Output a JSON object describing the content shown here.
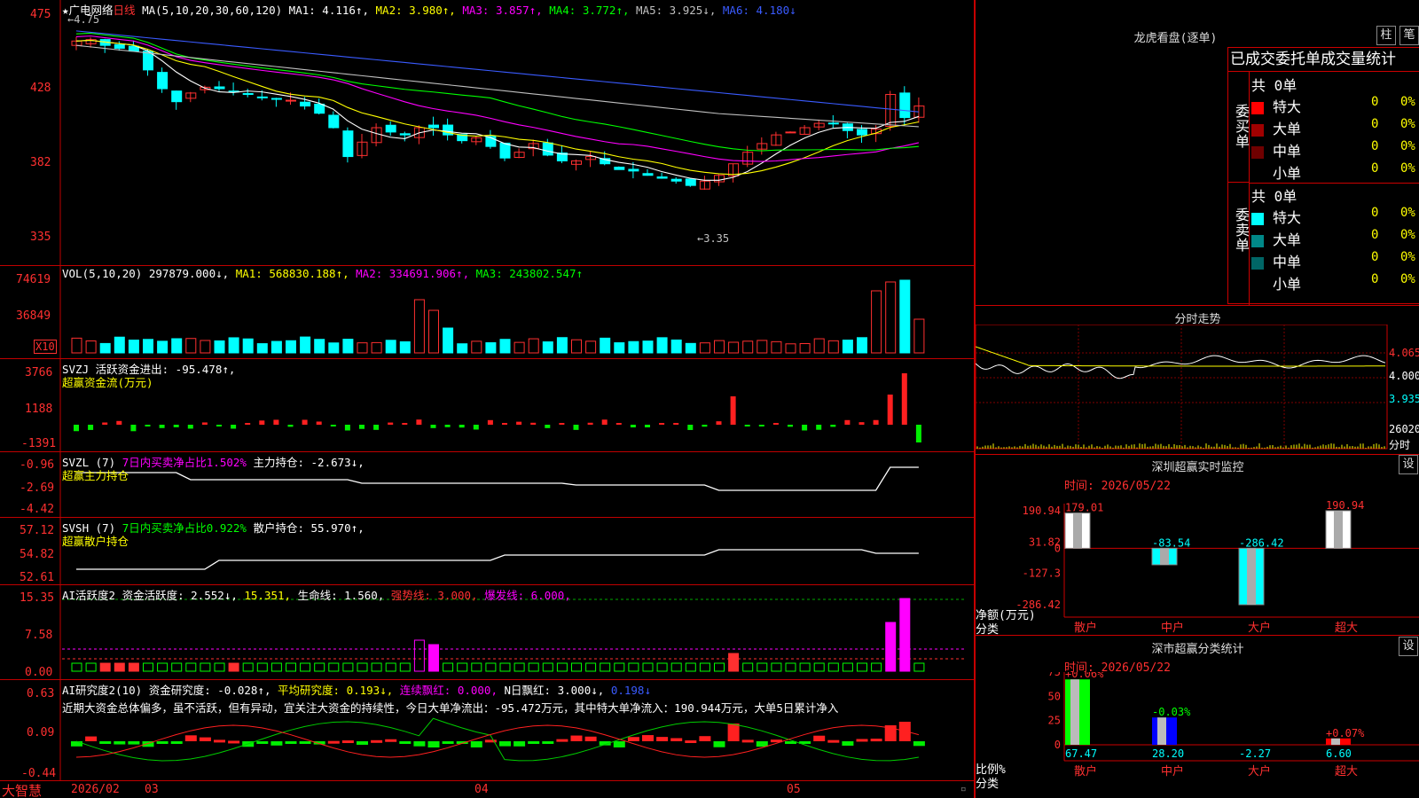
{
  "main": {
    "y_ticks": [
      "475",
      "428",
      "382",
      "335"
    ],
    "header": {
      "stock": "广电网络",
      "period": "日线",
      "ma_label": "MA(5,10,20,30,60,120)",
      "ma1": "MA1: 4.116↑,",
      "ma2": "MA2: 3.980↑,",
      "ma3": "MA3: 3.857↑,",
      "ma4": "MA4: 3.772↑,",
      "ma5": "MA5: 3.925↓,",
      "ma6": "MA6: 4.180↓"
    },
    "high_label": "4.75",
    "low_label": "3.35"
  },
  "vol": {
    "y_ticks": [
      "74619",
      "36849"
    ],
    "x10": "X10",
    "title": "VOL(5,10,20)",
    "v": "297879.000↓,",
    "ma1": "MA1: 568830.188↑,",
    "ma2": "MA2: 334691.906↑,",
    "ma3": "MA3: 243802.547↑"
  },
  "svzj": {
    "y_ticks": [
      "3766",
      "1188",
      "-1391"
    ],
    "line1": "SVZJ  活跃资金进出: -95.478↑,",
    "line2": "超赢资金流(万元)"
  },
  "svzl": {
    "y_ticks": [
      "-0.96",
      "-2.69",
      "-4.42"
    ],
    "t1": "SVZL (7)",
    "t2": "7日内买卖净占比1.502%",
    "t3": "主力持仓: -2.673↓,",
    "line2": "超赢主力持仓"
  },
  "svsh": {
    "y_ticks": [
      "57.12",
      "54.82",
      "52.61"
    ],
    "t1": "SVSH (7)",
    "t2": "7日内买卖净占比0.922%",
    "t3": "散户持仓: 55.970↑,",
    "line2": "超赢散户持仓"
  },
  "ai1": {
    "y_ticks": [
      "15.35",
      "7.58",
      "0.00"
    ],
    "t1": "AI活跃度2",
    "t2": "资金活跃度: 2.552↓,",
    "t3": "15.351,",
    "t4": "生命线: 1.560,",
    "t5": "强势线: 3.000,",
    "t6": "爆发线: 6.000,"
  },
  "ai2": {
    "y_ticks": [
      "0.63",
      "0.09",
      "-0.44"
    ],
    "t1": "AI研究度2(10)",
    "t2": "资金研究度: -0.028↑,",
    "t3": "平均研究度: 0.193↓,",
    "t4": "连续飘红: 0.000,",
    "t5": "N日飘红: 3.000↓,",
    "t6": "0.198↓",
    "comment": "近期大资金总体偏多，虽不活跃，但有异动，宜关注大资金的持续性，今日大单净流出：-95.472万元，其中特大单净流入：190.944万元，大单5日累计净入"
  },
  "xaxis": {
    "brand": "大智慧",
    "labels": [
      "2026/02",
      "03",
      "04",
      "05"
    ]
  },
  "lhb": {
    "title": "龙虎看盘(逐单)",
    "btn1": "柱",
    "btn2": "笔",
    "header": "已成交委托单成交量统计",
    "buy_label": "委买单",
    "sell_label": "委卖单",
    "buy_total": "共 0单",
    "sell_total": "共 0单",
    "buy_rows": [
      {
        "name": "特大",
        "count": "0",
        "pct": "0%",
        "color": "#ff0000"
      },
      {
        "name": "大单",
        "count": "0",
        "pct": "0%",
        "color": "#a00000"
      },
      {
        "name": "中单",
        "count": "0",
        "pct": "0%",
        "color": "#700000"
      },
      {
        "name": "小单",
        "count": "0",
        "pct": "0%",
        "color": "#000000"
      }
    ],
    "sell_rows": [
      {
        "name": "特大",
        "count": "0",
        "pct": "0%",
        "color": "#00ffff"
      },
      {
        "name": "大单",
        "count": "0",
        "pct": "0%",
        "color": "#008888"
      },
      {
        "name": "中单",
        "count": "0",
        "pct": "0%",
        "color": "#006666"
      },
      {
        "name": "小单",
        "count": "0",
        "pct": "0%",
        "color": "#000000"
      }
    ]
  },
  "fenshi": {
    "title": "分时走势",
    "p1": "4.065",
    "p2": "4.000",
    "p3": "3.935",
    "vol": "26020",
    "unit": "分时"
  },
  "sz_monitor": {
    "title": "深圳超赢实时监控",
    "btn": "设",
    "time": "时间: 2026/05/22",
    "y_ticks": [
      "190.94",
      "31.82",
      "0",
      "-127.3",
      "-286.42"
    ],
    "axis_label1": "净额(万元)",
    "axis_label2": "分类",
    "bars": [
      {
        "cat": "散户",
        "value": 179.01,
        "label": "179.01",
        "color": "#ffffff"
      },
      {
        "cat": "中户",
        "value": -83.54,
        "label": "-83.54",
        "color": "#00ffff"
      },
      {
        "cat": "大户",
        "value": -286.42,
        "label": "-286.42",
        "color": "#00ffff"
      },
      {
        "cat": "超大",
        "value": 190.94,
        "label": "190.94",
        "color": "#ffffff"
      }
    ]
  },
  "sz_class": {
    "title": "深市超赢分类统计",
    "btn": "设",
    "time": "时间: 2026/05/22",
    "y_ticks": [
      "75",
      "50",
      "25",
      "0"
    ],
    "axis_label1": "比例%",
    "axis_label2": "分类",
    "bars": [
      {
        "cat": "散户",
        "value": 67.47,
        "label": "67.47",
        "top": "+0.06%"
      },
      {
        "cat": "中户",
        "value": 28.2,
        "label": "28.20",
        "top": "-0.03%"
      },
      {
        "cat": "大户",
        "value": -2.27,
        "label": "-2.27",
        "top": ""
      },
      {
        "cat": "超大",
        "value": 6.6,
        "label": "6.60",
        "top": "+0.07%"
      }
    ]
  }
}
